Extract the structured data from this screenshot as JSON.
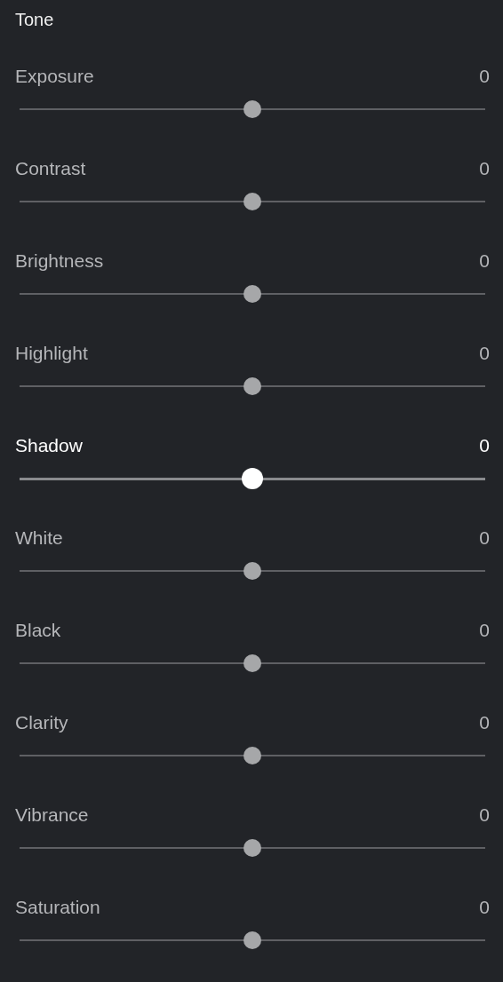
{
  "section": {
    "title": "Tone"
  },
  "adjustments": [
    {
      "label": "Exposure",
      "value": "0",
      "level": 0.5,
      "active": false
    },
    {
      "label": "Contrast",
      "value": "0",
      "level": 0.5,
      "active": false
    },
    {
      "label": "Brightness",
      "value": "0",
      "level": 0.5,
      "active": false
    },
    {
      "label": "Highlight",
      "value": "0",
      "level": 0.5,
      "active": false
    },
    {
      "label": "Shadow",
      "value": "0",
      "level": 0.5,
      "active": true
    },
    {
      "label": "White",
      "value": "0",
      "level": 0.5,
      "active": false
    },
    {
      "label": "Black",
      "value": "0",
      "level": 0.5,
      "active": false
    },
    {
      "label": "Clarity",
      "value": "0",
      "level": 0.5,
      "active": false
    },
    {
      "label": "Vibrance",
      "value": "0",
      "level": 0.5,
      "active": false
    },
    {
      "label": "Saturation",
      "value": "0",
      "level": 0.5,
      "active": false
    }
  ]
}
